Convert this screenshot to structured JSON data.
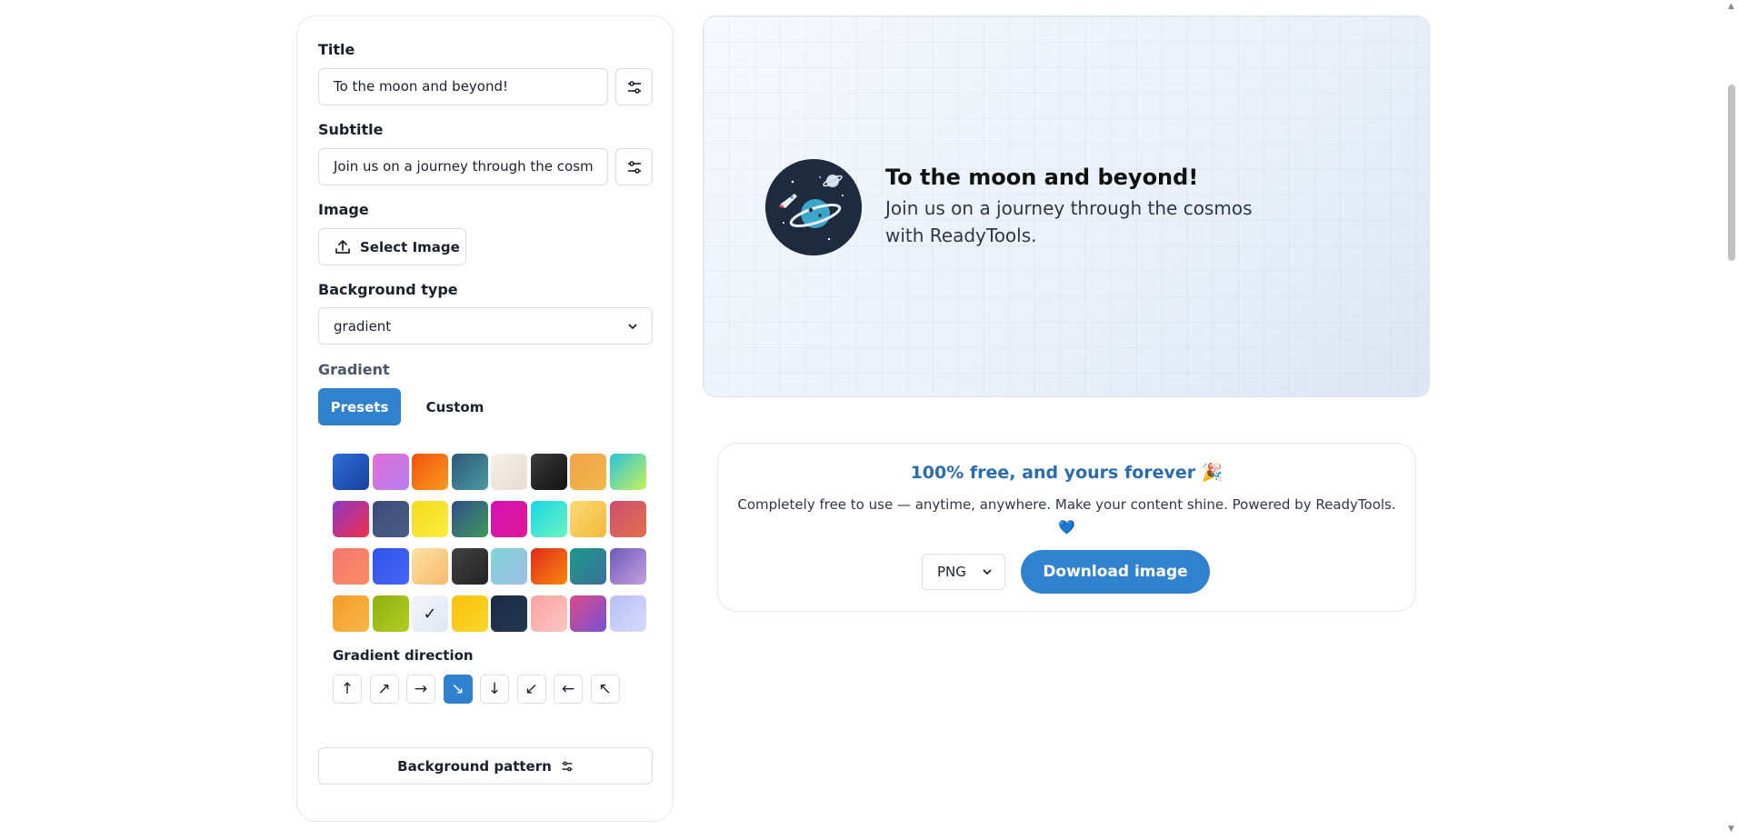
{
  "form": {
    "title_label": "Title",
    "title_value": "To the moon and beyond!",
    "subtitle_label": "Subtitle",
    "subtitle_value": "Join us on a journey through the cosm",
    "image_label": "Image",
    "select_image_label": "Select Image",
    "bg_type_label": "Background type",
    "bg_type_value": "gradient",
    "gradient_label": "Gradient",
    "tabs": {
      "presets": "Presets",
      "custom": "Custom"
    },
    "presets": [
      {
        "gradient": "linear-gradient(135deg,#2c6fd8,#1a3e9e)"
      },
      {
        "gradient": "linear-gradient(135deg,#e26fd6,#b67ff0)"
      },
      {
        "gradient": "linear-gradient(135deg,#f7510c,#f59b1e)"
      },
      {
        "gradient": "linear-gradient(135deg,#2b5876,#4e9aa3)"
      },
      {
        "gradient": "linear-gradient(135deg,#f6f1ea,#e7dcd0)"
      },
      {
        "gradient": "linear-gradient(135deg,#3c3c3c,#111111)"
      },
      {
        "gradient": "linear-gradient(135deg,#f2a24a,#f0b84b)"
      },
      {
        "gradient": "linear-gradient(135deg,#29c3d9,#c8f25a)"
      },
      {
        "gradient": "linear-gradient(135deg,#8a37c4,#f0314a)"
      },
      {
        "gradient": "linear-gradient(135deg,#3c4a7a,#4a5f85)"
      },
      {
        "gradient": "linear-gradient(135deg,#f5d820,#fcef3c)"
      },
      {
        "gradient": "linear-gradient(135deg,#2f4d88,#3f9a5c)"
      },
      {
        "gradient": "linear-gradient(135deg,#d411b8,#e01894)"
      },
      {
        "gradient": "linear-gradient(135deg,#1ad6e6,#6bf5c0)"
      },
      {
        "gradient": "linear-gradient(135deg,#f8da74,#f5b93a)"
      },
      {
        "gradient": "linear-gradient(135deg,#cf4d6f,#e0714e)"
      },
      {
        "gradient": "linear-gradient(135deg,#f5766f,#fb8d64)"
      },
      {
        "gradient": "linear-gradient(135deg,#2e52e8,#4866f5)"
      },
      {
        "gradient": "linear-gradient(135deg,#fde1a4,#f7b96a)"
      },
      {
        "gradient": "linear-gradient(135deg,#424242,#232323)"
      },
      {
        "gradient": "linear-gradient(135deg,#7fd4d6,#a0bfe8)"
      },
      {
        "gradient": "linear-gradient(135deg,#e22a18,#f9890e)"
      },
      {
        "gradient": "linear-gradient(135deg,#1c9a8a,#3b6f9a)"
      },
      {
        "gradient": "linear-gradient(135deg,#6c5ab8,#c69fe0)"
      },
      {
        "gradient": "linear-gradient(135deg,#f59a28,#f7b847)"
      },
      {
        "gradient": "linear-gradient(135deg,#8fb011,#b3cc24)"
      },
      {
        "gradient": "linear-gradient(135deg,#f3f6fb,#dfe7f3)",
        "selected": true
      },
      {
        "gradient": "linear-gradient(135deg,#f8c10a,#fcd82b)"
      },
      {
        "gradient": "linear-gradient(135deg,#1b2a44,#243852)"
      },
      {
        "gradient": "linear-gradient(135deg,#fba3a3,#fbc6c1)"
      },
      {
        "gradient": "linear-gradient(135deg,#d94a8a,#7952d1)"
      },
      {
        "gradient": "linear-gradient(135deg,#b8bff5,#d5dbfc)"
      }
    ],
    "selected_check": "✓",
    "direction_label": "Gradient direction",
    "directions": [
      {
        "glyph": "↑",
        "name": "up"
      },
      {
        "glyph": "↗",
        "name": "up-right"
      },
      {
        "glyph": "→",
        "name": "right"
      },
      {
        "glyph": "↘",
        "name": "down-right",
        "active": true
      },
      {
        "glyph": "↓",
        "name": "down"
      },
      {
        "glyph": "↙",
        "name": "down-left"
      },
      {
        "glyph": "←",
        "name": "left"
      },
      {
        "glyph": "↖",
        "name": "up-left"
      }
    ],
    "bg_pattern_label": "Background pattern"
  },
  "preview": {
    "title": "To the moon and beyond!",
    "subtitle": "Join us on a journey through the cosmos with ReadyTools.",
    "avatar_icon": "planet-rocket-icon"
  },
  "download": {
    "headline": "100% free, and yours forever 🎉",
    "description": "Completely free to use — anytime, anywhere. Make your content shine. Powered by ReadyTools.",
    "heart": "💙",
    "format_value": "PNG",
    "button_label": "Download image"
  },
  "colors": {
    "accent": "#3182ce",
    "headline": "#2b6cb0",
    "border": "#e2e8f0"
  }
}
